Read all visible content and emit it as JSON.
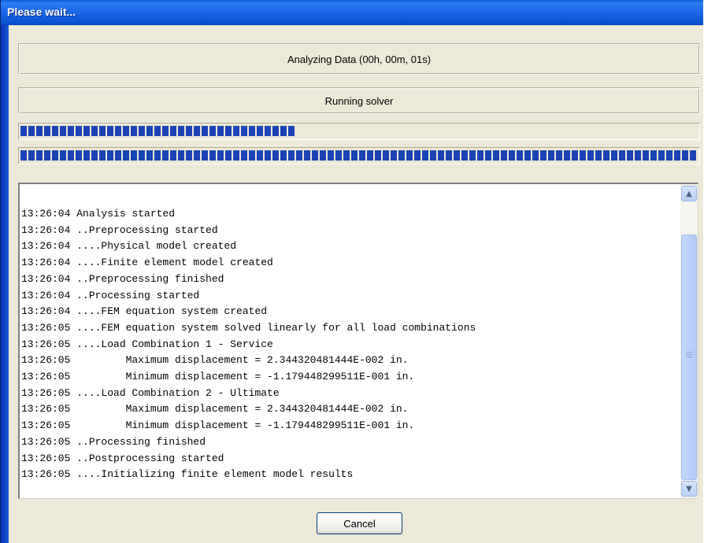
{
  "window": {
    "title": "Please wait..."
  },
  "status": {
    "analyzing": "Analyzing Data (00h, 00m, 01s)",
    "step": "Running solver"
  },
  "progress": {
    "task_fraction": 0.41,
    "overall_fraction": 1.0
  },
  "log": {
    "lines": [
      "13:26:04 Analysis started",
      "13:26:04 ..Preprocessing started",
      "13:26:04 ....Physical model created",
      "13:26:04 ....Finite element model created",
      "13:26:04 ..Preprocessing finished",
      "13:26:04 ..Processing started",
      "13:26:04 ....FEM equation system created",
      "13:26:05 ....FEM equation system solved linearly for all load combinations",
      "13:26:05 ....Load Combination 1 - Service",
      "13:26:05         Maximum displacement = 2.344320481444E-002 in.",
      "13:26:05         Minimum displacement = -1.179448299511E-001 in.",
      "13:26:05 ....Load Combination 2 - Ultimate",
      "13:26:05         Maximum displacement = 2.344320481444E-002 in.",
      "13:26:05         Minimum displacement = -1.179448299511E-001 in.",
      "13:26:05 ..Processing finished",
      "13:26:05 ..Postprocessing started",
      "13:26:05 ....Initializing finite element model results"
    ]
  },
  "icons": {
    "scroll_up": "chevron-up-icon",
    "scroll_down": "chevron-down-icon"
  },
  "buttons": {
    "cancel": "Cancel"
  },
  "colors": {
    "titlebar": "#0b55d5",
    "progress_fill": "#1b44b8",
    "dialog_bg": "#ece9d8"
  }
}
